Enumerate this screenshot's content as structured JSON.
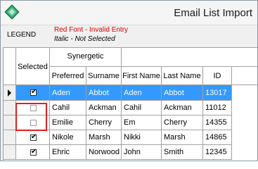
{
  "window": {
    "title": "Email List Import",
    "app_icon": "green-diamond-icon"
  },
  "legend": {
    "label": "LEGEND",
    "red_entry": "Red Font - Invalid Entry",
    "italic_entry": "Italic - Not Selected",
    "red_color": "#e00000"
  },
  "grid": {
    "group_header": "Synergetic",
    "columns": {
      "selected": "Selected",
      "preferred": "Preferred",
      "surname": "Surname",
      "first_name": "First Name",
      "last_name": "Last Name",
      "id": "ID"
    },
    "selection_color": "#3399ff",
    "rows": [
      {
        "selected": true,
        "current": true,
        "preferred": "Aden",
        "surname": "Abbot",
        "first_name": "Aden",
        "last_name": "Abbot",
        "id": "13017"
      },
      {
        "selected": false,
        "current": false,
        "preferred": "Cahil",
        "surname": "Ackman",
        "first_name": "Cahil",
        "last_name": "Ackman",
        "id": "11012"
      },
      {
        "selected": false,
        "current": false,
        "preferred": "Emilie",
        "surname": "Cherry",
        "first_name": "Em",
        "last_name": "Cherry",
        "id": "14355"
      },
      {
        "selected": true,
        "current": false,
        "preferred": "Nikole",
        "surname": "Marsh",
        "first_name": "Nikki",
        "last_name": "Marsh",
        "id": "14865"
      },
      {
        "selected": true,
        "current": false,
        "preferred": "Ehric",
        "surname": "Norwood",
        "first_name": "John",
        "last_name": "Smith",
        "id": "12345"
      }
    ]
  }
}
